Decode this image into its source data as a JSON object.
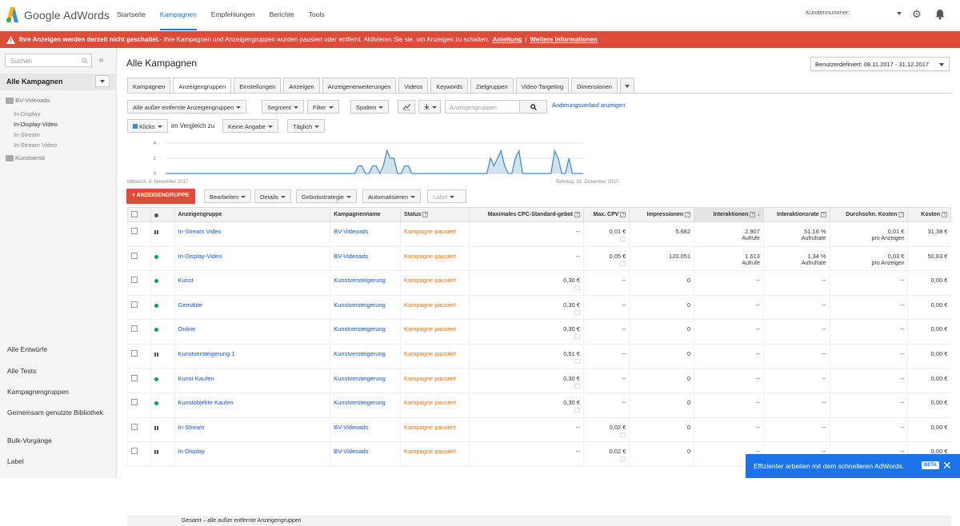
{
  "app": {
    "logo_text": "Google AdWords"
  },
  "topnav": [
    {
      "label": "Startseite"
    },
    {
      "label": "Kampagnen"
    },
    {
      "label": "Empfehlungen"
    },
    {
      "label": "Berichte"
    },
    {
      "label": "Tools"
    }
  ],
  "header": {
    "customer_label": "Kundennummer: "
  },
  "alert": {
    "bold": "Ihre Anzeigen werden derzeit nicht geschaltet.",
    "text": " - Ihre Kampagnen und Anzeigengruppen wurden pausiert oder entfernt. Aktivieren Sie sie, um Anzeigen zu schalten.",
    "link1": "Anleitung",
    "sep": "|",
    "link2": "Weitere Informationen"
  },
  "sidebar": {
    "search_placeholder": "Suchen",
    "collapse": "«",
    "all_campaigns": "Alle Kampagnen",
    "campaign1": "BV-Videoads",
    "campaign1_groups": [
      "In-Display",
      "In-Display-Video",
      "In-Stream",
      "In-Stream Video"
    ],
    "campaign2": "Kunstversti",
    "links": [
      "Alle Entwürfe",
      "Alle Tests",
      "Kampagnengruppen",
      "Gemeinsam genutzte Bibliothek",
      "Bulk-Vorgänge",
      "Label"
    ]
  },
  "main": {
    "title": "Alle Kampagnen",
    "date_range": "Benutzerdefiniert: 08.11.2017 - 31.12.2017",
    "tabs": [
      "Kampagnen",
      "Anzeigengruppen",
      "Einstellungen",
      "Anzeigen",
      "Anzeigenerweiterungen",
      "Videos",
      "Keywords",
      "Zielgruppen",
      "Video-Targeting",
      "Dimensionen"
    ],
    "toolbar": {
      "filter_all": "Alle außer entfernte Anzeigengruppen",
      "segment": "Segment",
      "filter": "Filter",
      "columns": "Spalten",
      "search_placeholder": "Anzeigengruppen",
      "change_history": "Änderungsverlauf anzeigen"
    },
    "chart_controls": {
      "metric": "Klicks",
      "compare_label": "im Vergleich zu",
      "compare_value": "Keine Angabe",
      "interval": "Täglich"
    },
    "actions": {
      "add": "ANZEIGENGRUPPE",
      "edit": "Bearbeiten",
      "details": "Details",
      "bid_strategy": "Gebotsstrategie",
      "automate": "Automatisieren",
      "label": "Label"
    }
  },
  "chart_data": {
    "type": "area",
    "series_color": "#4a90c4",
    "y_ticks": [
      4,
      2,
      0
    ],
    "ylim": [
      0,
      4
    ],
    "x_start_label": "Mittwoch, 8. November 2017",
    "x_end_label": "Sonntag, 31. Dezember 2017",
    "values": [
      0,
      0,
      0,
      0,
      0,
      0,
      0,
      0,
      0,
      0,
      0,
      0,
      0,
      0,
      0,
      0,
      0,
      0,
      0,
      0,
      0,
      0,
      0,
      0,
      0,
      0,
      0,
      0,
      0,
      0,
      0,
      0,
      0,
      0,
      0,
      0,
      0,
      0,
      0,
      0,
      0,
      0,
      0,
      0,
      0,
      0,
      0,
      0,
      0,
      0,
      0,
      0,
      0,
      0,
      1,
      1,
      0,
      0,
      1,
      1,
      0,
      1,
      3,
      2,
      2,
      0,
      0,
      1,
      1,
      0,
      0,
      0,
      0,
      0,
      0,
      0,
      0,
      0,
      0,
      0,
      0,
      0,
      0,
      0,
      0,
      0,
      0,
      0,
      0,
      0,
      0,
      2,
      1,
      2,
      3,
      1,
      0,
      0,
      2,
      3,
      0,
      0,
      0,
      0,
      0,
      0,
      0,
      0,
      0,
      3,
      2,
      0,
      0,
      2,
      0,
      0,
      0,
      0
    ]
  },
  "table": {
    "headers": [
      "Anzeigengruppe",
      "Kampagnenname",
      "Status",
      "Maximales CPC-Standard-gebot",
      "Max. CPV",
      "Impressionen",
      "Interaktionen",
      "Interaktionsrate",
      "Durchschn. Kosten",
      "Kosten"
    ],
    "rows": [
      {
        "status_icon": "pause",
        "group": "In-Stream Video",
        "campaign": "BV-Videoads",
        "status": "Kampagne pausiert",
        "cpc": "--",
        "cpv": "0,01 €",
        "impr": "5.682",
        "inter": "2.907",
        "inter_sub": "Aufrufe",
        "rate": "51,16 %",
        "rate_sub": "Aufrufrate",
        "avg": "0,01 €",
        "avg_sub": "pro Anzeigen",
        "cost": "31,38 €"
      },
      {
        "status_icon": "dot",
        "group": "In-Display-Video",
        "campaign": "BV-Videoads",
        "status": "Kampagne pausiert",
        "cpc": "--",
        "cpv": "0,05 €",
        "impr": "120.051",
        "inter": "1.613",
        "inter_sub": "Aufrufe",
        "rate": "1,34 %",
        "rate_sub": "Aufrufrate",
        "avg": "0,03 €",
        "avg_sub": "pro Anzeigen",
        "cost": "50,83 €"
      },
      {
        "status_icon": "dot",
        "group": "Kunst",
        "campaign": "Kunstversteigerung",
        "status": "Kampagne pausiert",
        "cpc": "0,30 €",
        "cpv": "--",
        "impr": "0",
        "inter": "--",
        "inter_sub": "",
        "rate": "--",
        "rate_sub": "",
        "avg": "--",
        "avg_sub": "",
        "cost": "0,00 €"
      },
      {
        "status_icon": "dot",
        "group": "Gemälde",
        "campaign": "Kunstversteigerung",
        "status": "Kampagne pausiert",
        "cpc": "0,30 €",
        "cpv": "--",
        "impr": "0",
        "inter": "--",
        "inter_sub": "",
        "rate": "--",
        "rate_sub": "",
        "avg": "--",
        "avg_sub": "",
        "cost": "0,00 €"
      },
      {
        "status_icon": "dot",
        "group": "Online",
        "campaign": "Kunstversteigerung",
        "status": "Kampagne pausiert",
        "cpc": "0,30 €",
        "cpv": "--",
        "impr": "0",
        "inter": "--",
        "inter_sub": "",
        "rate": "--",
        "rate_sub": "",
        "avg": "--",
        "avg_sub": "",
        "cost": "0,00 €"
      },
      {
        "status_icon": "pause",
        "group": "Kunstversteigerung 1",
        "campaign": "Kunstversteigerung",
        "status": "Kampagne pausiert",
        "cpc": "0,51 €",
        "cpv": "--",
        "impr": "0",
        "inter": "--",
        "inter_sub": "",
        "rate": "--",
        "rate_sub": "",
        "avg": "--",
        "avg_sub": "",
        "cost": "0,00 €"
      },
      {
        "status_icon": "dot",
        "group": "Kunst Kaufen",
        "campaign": "Kunstversteigerung",
        "status": "Kampagne pausiert",
        "cpc": "0,30 €",
        "cpv": "--",
        "impr": "0",
        "inter": "--",
        "inter_sub": "",
        "rate": "--",
        "rate_sub": "",
        "avg": "--",
        "avg_sub": "",
        "cost": "0,00 €"
      },
      {
        "status_icon": "dot",
        "group": "Kunstobjekte Kaufen",
        "campaign": "Kunstversteigerung",
        "status": "Kampagne pausiert",
        "cpc": "0,30 €",
        "cpv": "--",
        "impr": "0",
        "inter": "--",
        "inter_sub": "",
        "rate": "--",
        "rate_sub": "",
        "avg": "--",
        "avg_sub": "",
        "cost": "0,00 €"
      },
      {
        "status_icon": "pause",
        "group": "In-Stream",
        "campaign": "BV-Videoads",
        "status": "Kampagne pausiert",
        "cpc": "--",
        "cpv": "0,02 €",
        "impr": "0",
        "inter": "--",
        "inter_sub": "",
        "rate": "--",
        "rate_sub": "",
        "avg": "--",
        "avg_sub": "",
        "cost": "0,00 €"
      },
      {
        "status_icon": "pause",
        "group": "In-Display",
        "campaign": "BV-Videoads",
        "status": "Kampagne pausiert",
        "cpc": "--",
        "cpv": "0,02 €",
        "impr": "0",
        "inter": "--",
        "inter_sub": "",
        "rate": "--",
        "rate_sub": "",
        "avg": "--",
        "avg_sub": "",
        "cost": "0,00 €"
      }
    ],
    "total_label": "Gesamt – alle außer entfernte Anzeigengruppen"
  },
  "toast": {
    "text": "Effizienter arbeiten mit dem schnelleren AdWords.",
    "badge": "BETA",
    "close": "✕"
  }
}
